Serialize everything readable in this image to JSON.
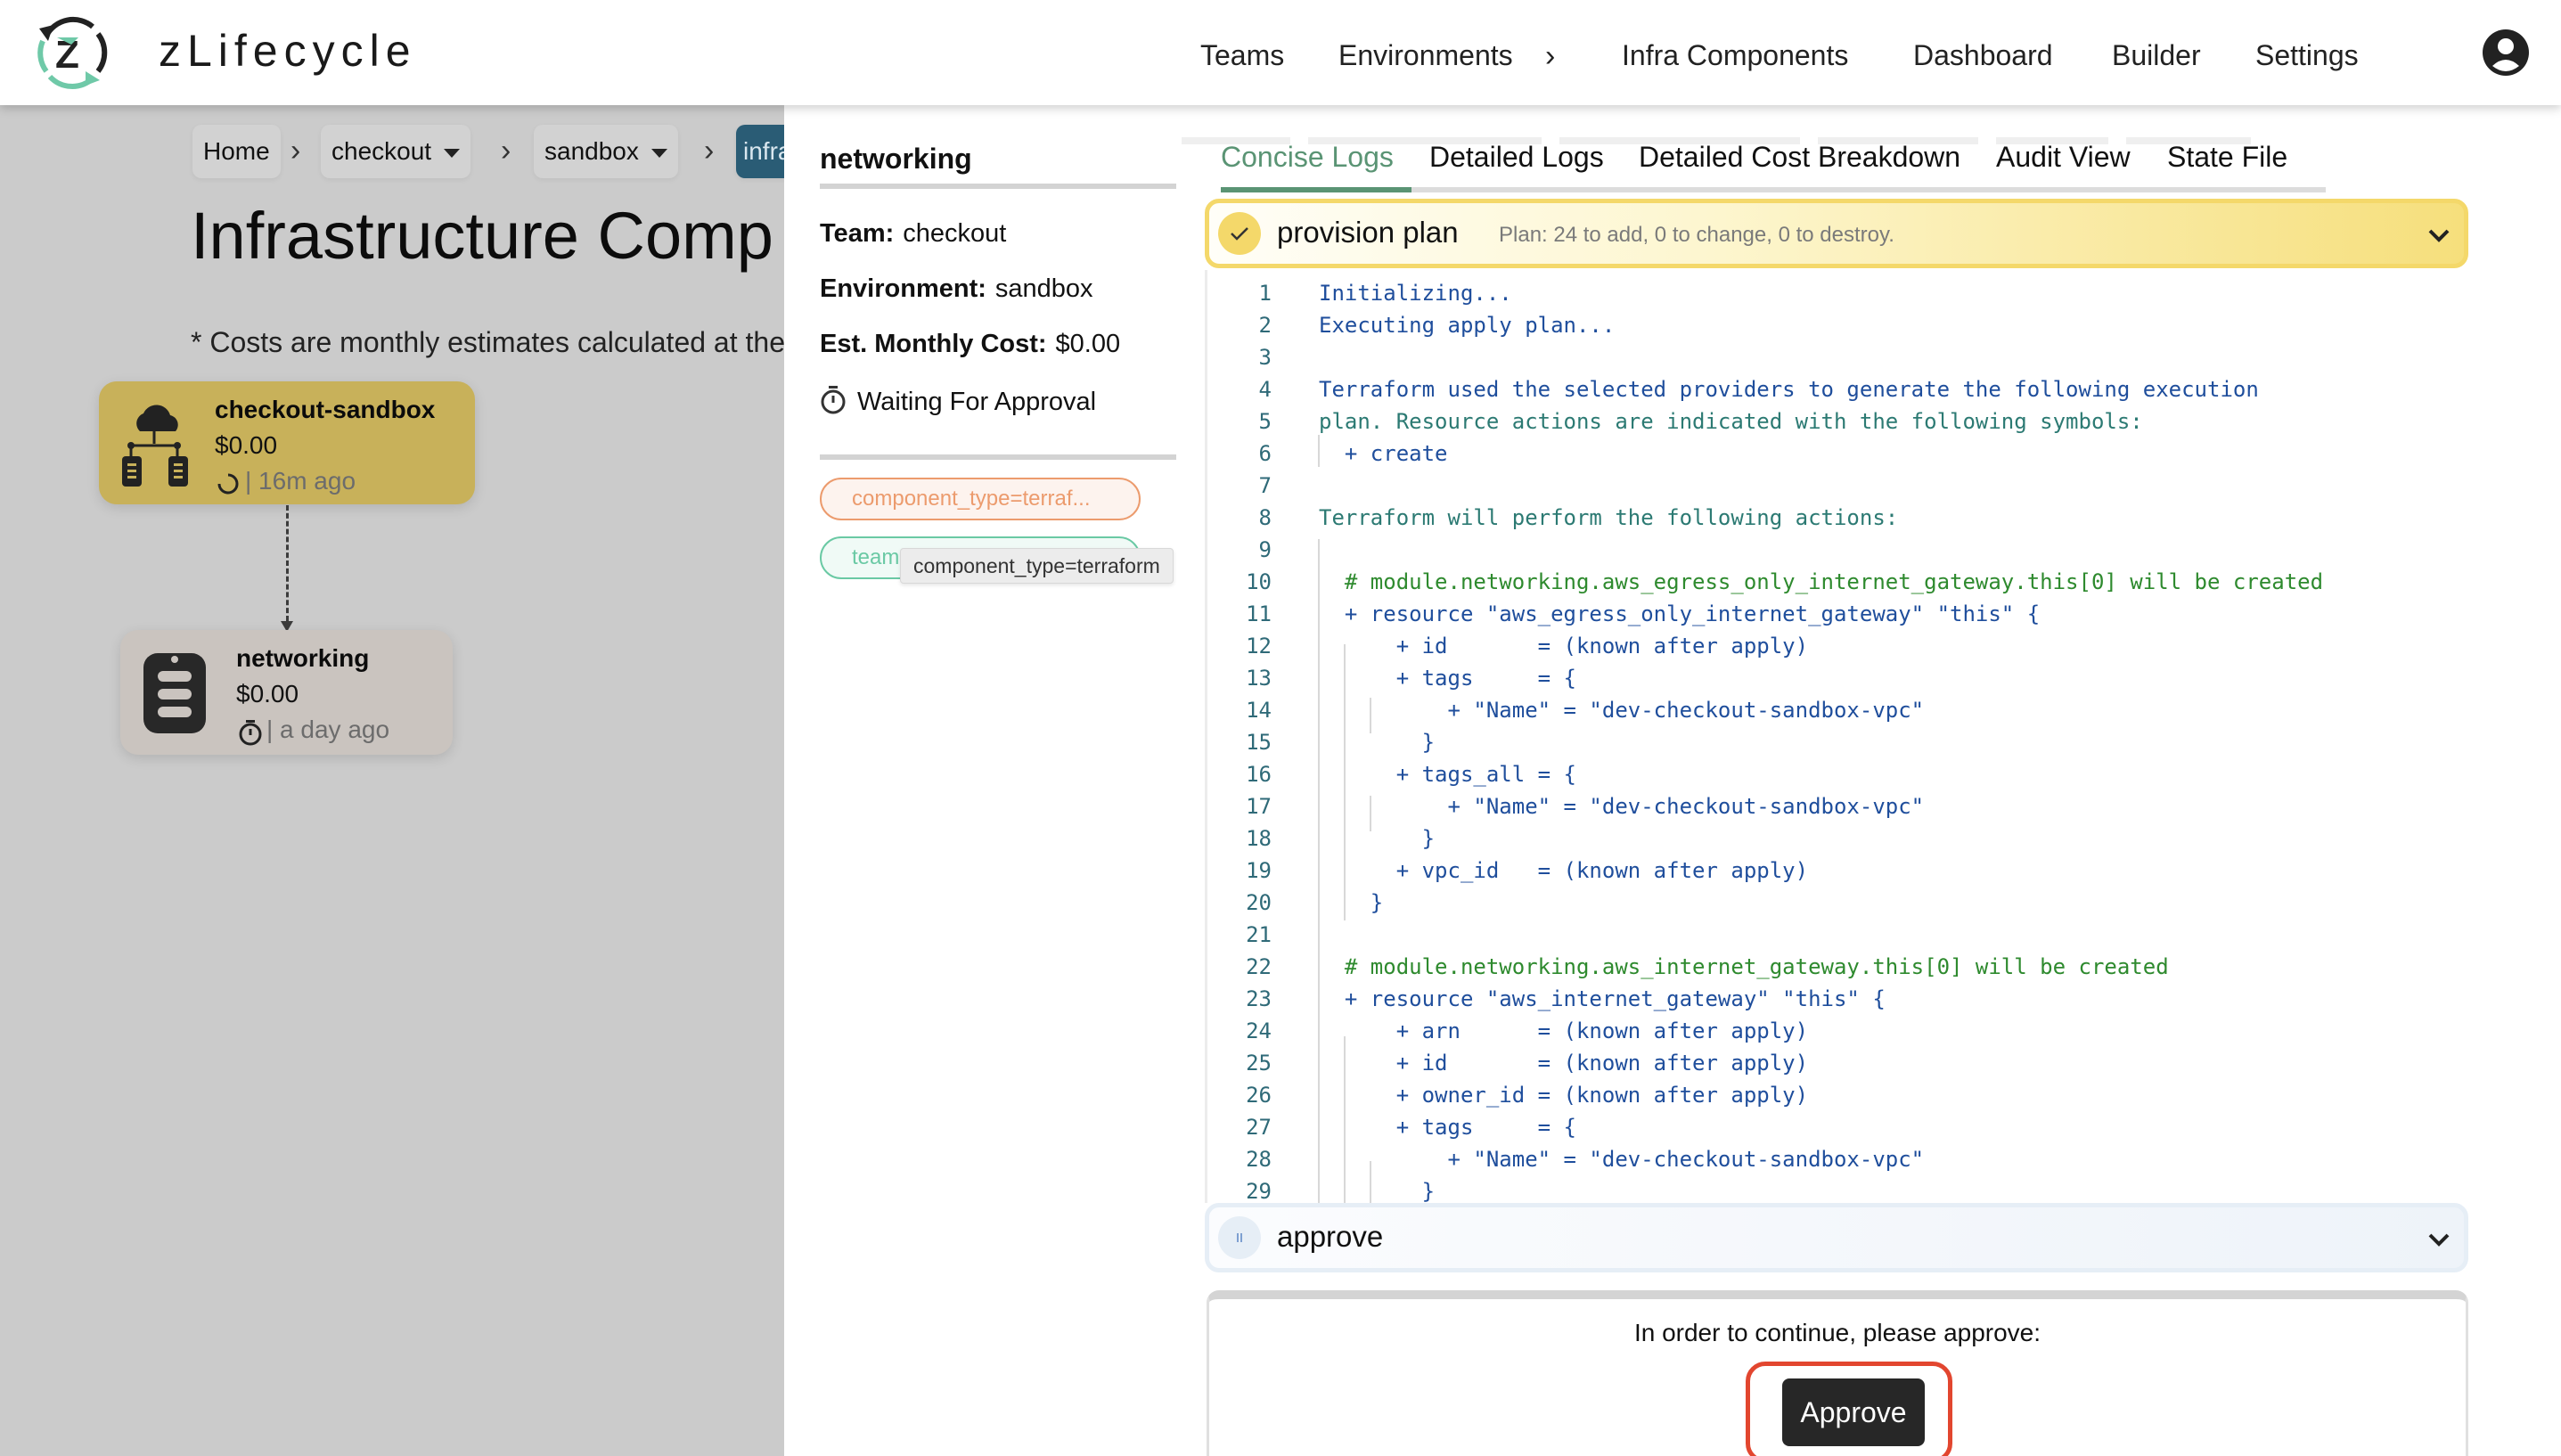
{
  "app": {
    "brand": "zLifecycle"
  },
  "nav": {
    "items": [
      {
        "label": "Teams"
      },
      {
        "label": "Environments"
      },
      {
        "label": "Infra Components"
      },
      {
        "label": "Dashboard"
      },
      {
        "label": "Builder"
      },
      {
        "label": "Settings"
      }
    ],
    "avatar_icon": "user-circle-icon"
  },
  "breadcrumb": {
    "items": [
      {
        "label": "Home"
      },
      {
        "label": "checkout",
        "dropdown": true
      },
      {
        "label": "sandbox",
        "dropdown": true
      },
      {
        "label": "infra",
        "active": true
      }
    ]
  },
  "page": {
    "title": "Infrastructure Comp",
    "cost_note": "* Costs are monthly estimates calculated at the"
  },
  "graph": {
    "nodes": [
      {
        "name": "checkout-sandbox",
        "cost": "$0.00",
        "status_icon": "spinner-icon",
        "meta": "| 16m ago",
        "color": "#c8b15a"
      },
      {
        "name": "networking",
        "cost": "$0.00",
        "status_icon": "stopwatch-icon",
        "meta": "| a day ago",
        "color": "#cac4bf"
      }
    ]
  },
  "side_panel": {
    "title": "networking",
    "team_label": "Team:",
    "team_value": "checkout",
    "env_label": "Environment:",
    "env_value": "sandbox",
    "cost_label": "Est. Monthly Cost:",
    "cost_value": "$0.00",
    "status": "Waiting For Approval",
    "tags": [
      {
        "text": "component_type=terraf...",
        "color": "#ec9b6d"
      },
      {
        "text": "team",
        "color": "#6ac9a4"
      }
    ],
    "tooltip": "component_type=terraform"
  },
  "tabs": {
    "items": [
      {
        "label": "Concise Logs",
        "active": true
      },
      {
        "label": "Detailed Logs"
      },
      {
        "label": "Detailed Cost Breakdown"
      },
      {
        "label": "Audit View"
      },
      {
        "label": "State File"
      }
    ],
    "active_color": "#5a9474"
  },
  "steps": {
    "plan": {
      "label": "provision plan",
      "description": "Plan: 24 to add, 0 to change, 0 to destroy.",
      "status": "complete"
    },
    "approve": {
      "label": "approve",
      "status": "paused"
    }
  },
  "log": {
    "lines": [
      {
        "n": "1",
        "text": "Initializing...",
        "style": ""
      },
      {
        "n": "2",
        "text": "Executing apply plan...",
        "style": ""
      },
      {
        "n": "3",
        "text": "",
        "style": ""
      },
      {
        "n": "4",
        "text": "Terraform used the selected providers to generate the following execution",
        "style": ""
      },
      {
        "n": "5",
        "text": "plan. Resource actions are indicated with the following symbols:",
        "style": "teal"
      },
      {
        "n": "6",
        "text": "  + create",
        "style": ""
      },
      {
        "n": "7",
        "text": "",
        "style": ""
      },
      {
        "n": "8",
        "text": "Terraform will perform the following actions:",
        "style": "teal"
      },
      {
        "n": "9",
        "text": "",
        "style": ""
      },
      {
        "n": "10",
        "text": "  # module.networking.aws_egress_only_internet_gateway.this[0] will be created",
        "style": "green"
      },
      {
        "n": "11",
        "text": "  + resource \"aws_egress_only_internet_gateway\" \"this\" {",
        "style": ""
      },
      {
        "n": "12",
        "text": "      + id       = (known after apply)",
        "style": ""
      },
      {
        "n": "13",
        "text": "      + tags     = {",
        "style": ""
      },
      {
        "n": "14",
        "text": "          + \"Name\" = \"dev-checkout-sandbox-vpc\"",
        "style": ""
      },
      {
        "n": "15",
        "text": "        }",
        "style": ""
      },
      {
        "n": "16",
        "text": "      + tags_all = {",
        "style": ""
      },
      {
        "n": "17",
        "text": "          + \"Name\" = \"dev-checkout-sandbox-vpc\"",
        "style": ""
      },
      {
        "n": "18",
        "text": "        }",
        "style": ""
      },
      {
        "n": "19",
        "text": "      + vpc_id   = (known after apply)",
        "style": ""
      },
      {
        "n": "20",
        "text": "    }",
        "style": ""
      },
      {
        "n": "21",
        "text": "",
        "style": ""
      },
      {
        "n": "22",
        "text": "  # module.networking.aws_internet_gateway.this[0] will be created",
        "style": "green"
      },
      {
        "n": "23",
        "text": "  + resource \"aws_internet_gateway\" \"this\" {",
        "style": ""
      },
      {
        "n": "24",
        "text": "      + arn      = (known after apply)",
        "style": ""
      },
      {
        "n": "25",
        "text": "      + id       = (known after apply)",
        "style": ""
      },
      {
        "n": "26",
        "text": "      + owner_id = (known after apply)",
        "style": ""
      },
      {
        "n": "27",
        "text": "      + tags     = {",
        "style": ""
      },
      {
        "n": "28",
        "text": "          + \"Name\" = \"dev-checkout-sandbox-vpc\"",
        "style": ""
      },
      {
        "n": "29",
        "text": "        }",
        "style": ""
      }
    ]
  },
  "approve": {
    "message": "In order to continue, please approve:",
    "button_label": "Approve",
    "highlight_color": "#e2462f"
  }
}
